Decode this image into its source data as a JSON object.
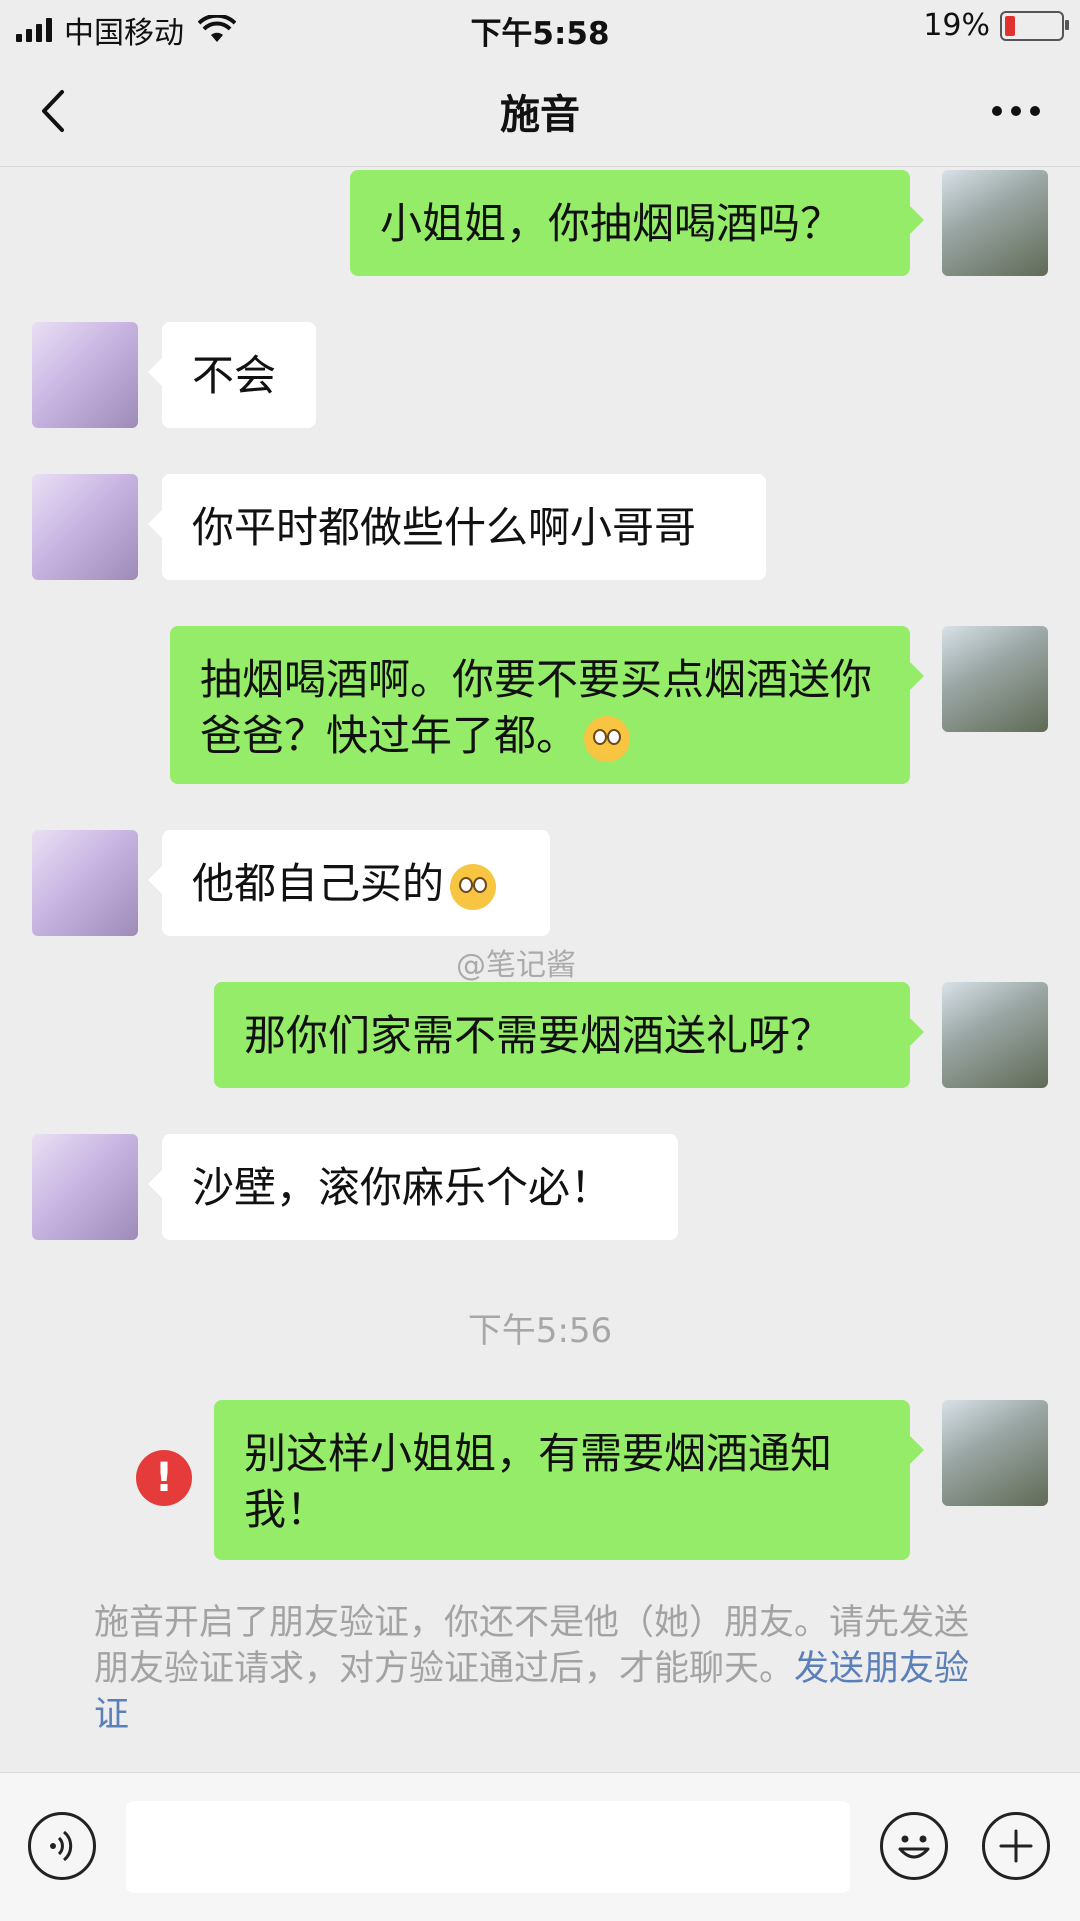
{
  "status_bar": {
    "carrier": "中国移动",
    "time": "下午5:58",
    "battery": "19%",
    "battery_level": 0.19
  },
  "nav": {
    "title": "施音"
  },
  "messages": [
    {
      "side": "out",
      "text": "小姐姐，你抽烟喝酒吗？"
    },
    {
      "side": "in",
      "text": "不会"
    },
    {
      "side": "in",
      "text": "你平时都做些什么啊小哥哥"
    },
    {
      "side": "out",
      "text": "抽烟喝酒啊。你要不要买点烟酒送你爸爸？快过年了都。",
      "emoji": "flushed-face-emoji"
    },
    {
      "side": "in",
      "text": "他都自己买的",
      "emoji": "sweat-face-emoji"
    },
    {
      "side": "out",
      "text": "那你们家需不需要烟酒送礼呀？"
    },
    {
      "side": "in",
      "text": "沙壁，滚你麻乐个必！"
    },
    {
      "side": "out",
      "text": "别这样小姐姐，有需要烟酒通知我！",
      "failed": true
    }
  ],
  "watermark": "@笔记酱",
  "time_divider": "下午5:56",
  "system_notice": {
    "text": "施音开启了朋友验证，你还不是他（她）朋友。请先发送朋友验证请求，对方验证通过后，才能聊天。",
    "link": "发送朋友验证"
  },
  "input_bar": {
    "placeholder": ""
  },
  "colors": {
    "outgoing_bubble": "#95ec69",
    "incoming_bubble": "#ffffff",
    "background": "#ededed",
    "link": "#5b7fb8",
    "error": "#e63b3b"
  }
}
